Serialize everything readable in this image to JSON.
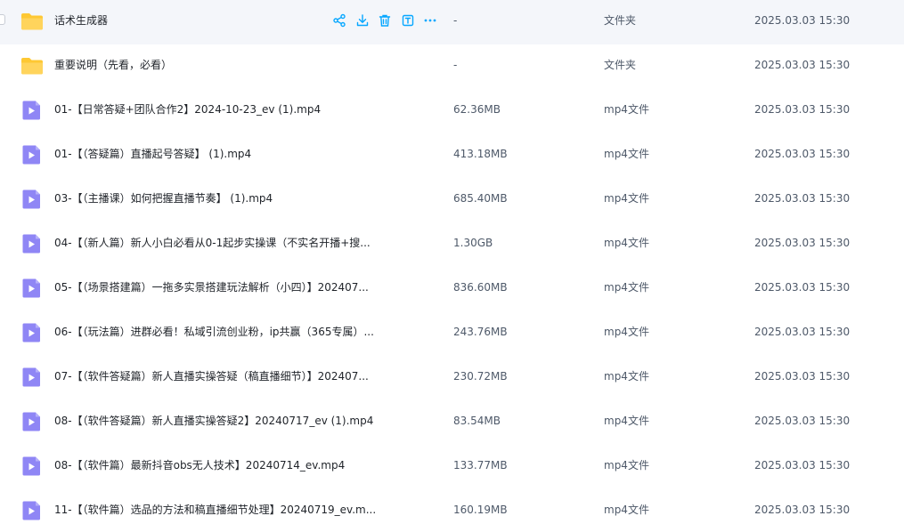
{
  "colors": {
    "folder": "#fec833",
    "video": "#8f86f5",
    "action": "#06a7ff",
    "hover_bg": "#f4f6fa"
  },
  "files": [
    {
      "name": "话术生成器",
      "size": "-",
      "type": "文件夹",
      "date": "2025.03.03 15:30",
      "kind": "folder",
      "hovered": true
    },
    {
      "name": "重要说明（先看，必看）",
      "size": "-",
      "type": "文件夹",
      "date": "2025.03.03 15:30",
      "kind": "folder"
    },
    {
      "name": "01-【日常答疑+团队合作2】2024-10-23_ev (1).mp4",
      "size": "62.36MB",
      "type": "mp4文件",
      "date": "2025.03.03 15:30",
      "kind": "video"
    },
    {
      "name": "01-【（答疑篇）直播起号答疑】 (1).mp4",
      "size": "413.18MB",
      "type": "mp4文件",
      "date": "2025.03.03 15:30",
      "kind": "video"
    },
    {
      "name": "03-【（主播课）如何把握直播节奏】 (1).mp4",
      "size": "685.40MB",
      "type": "mp4文件",
      "date": "2025.03.03 15:30",
      "kind": "video"
    },
    {
      "name": "04-【（新人篇）新人小白必看从0-1起步实操课（不实名开播+搜...",
      "size": "1.30GB",
      "type": "mp4文件",
      "date": "2025.03.03 15:30",
      "kind": "video"
    },
    {
      "name": "05-【（场景搭建篇）一拖多实景搭建玩法解析（小四）】202407...",
      "size": "836.60MB",
      "type": "mp4文件",
      "date": "2025.03.03 15:30",
      "kind": "video"
    },
    {
      "name": "06-【（玩法篇）进群必看！私域引流创业粉，ip共赢（365专属）...",
      "size": "243.76MB",
      "type": "mp4文件",
      "date": "2025.03.03 15:30",
      "kind": "video"
    },
    {
      "name": "07-【（软件答疑篇）新人直播实操答疑（稿直播细节）】202407...",
      "size": "230.72MB",
      "type": "mp4文件",
      "date": "2025.03.03 15:30",
      "kind": "video"
    },
    {
      "name": "08-【（软件答疑篇）新人直播实操答疑2】20240717_ev (1).mp4",
      "size": "83.54MB",
      "type": "mp4文件",
      "date": "2025.03.03 15:30",
      "kind": "video"
    },
    {
      "name": "08-【（软件篇）最新抖音obs无人技术】20240714_ev.mp4",
      "size": "133.77MB",
      "type": "mp4文件",
      "date": "2025.03.03 15:30",
      "kind": "video"
    },
    {
      "name": "11-【（软件篇）选品的方法和稿直播细节处理】20240719_ev.m...",
      "size": "160.19MB",
      "type": "mp4文件",
      "date": "2025.03.03 15:30",
      "kind": "video"
    }
  ],
  "row_actions": [
    {
      "icon": "share-icon"
    },
    {
      "icon": "download-icon"
    },
    {
      "icon": "delete-icon"
    },
    {
      "icon": "rename-icon"
    },
    {
      "icon": "more-icon"
    }
  ]
}
